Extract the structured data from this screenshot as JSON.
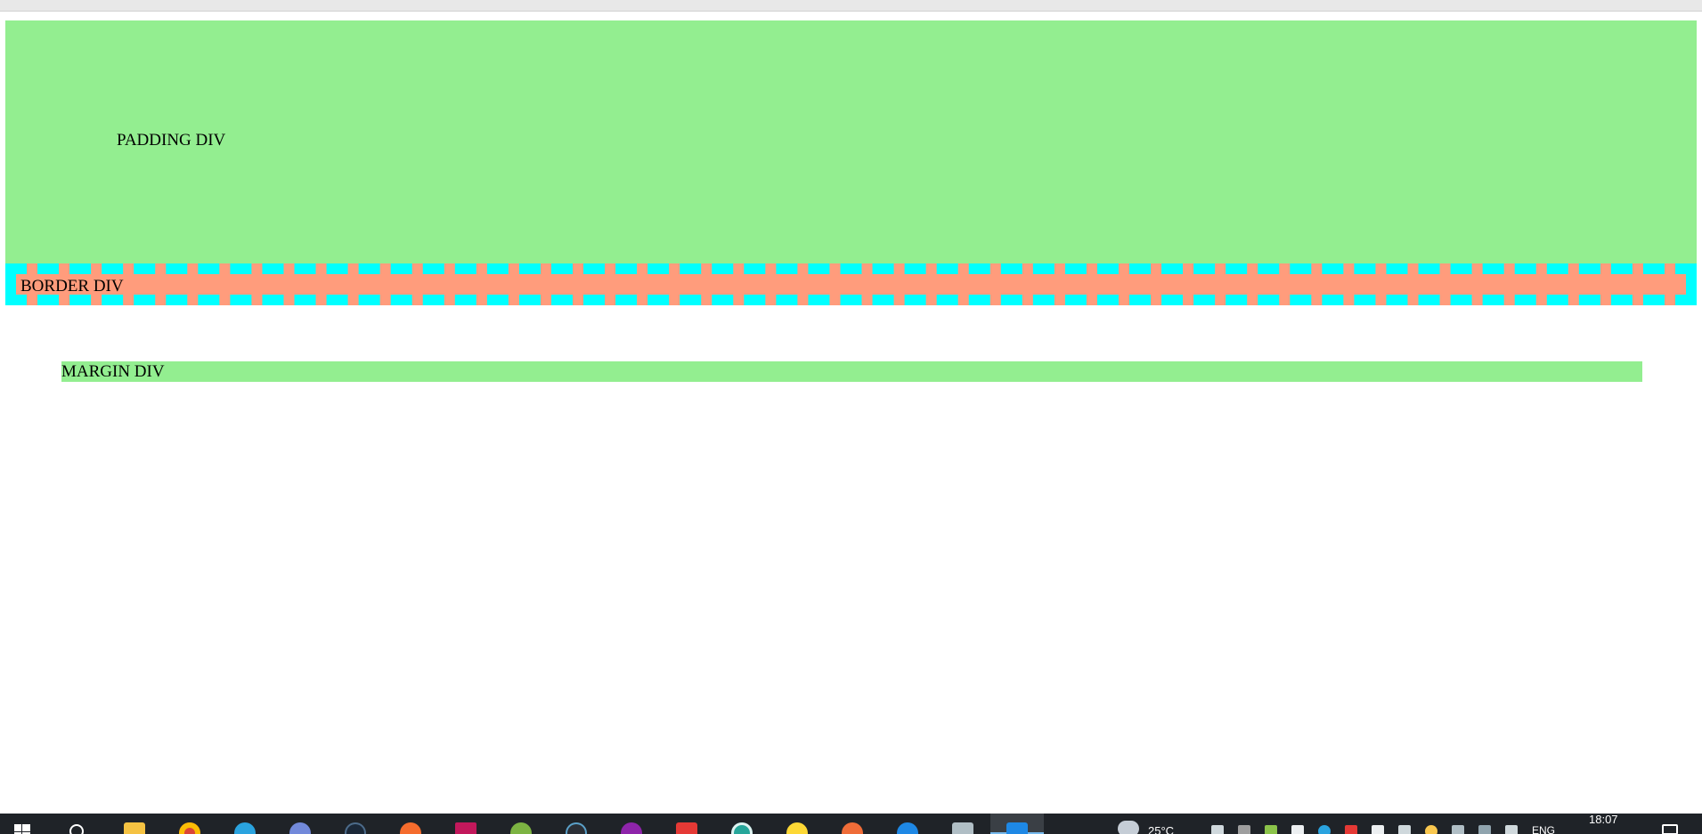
{
  "page": {
    "padding_div_label": "PADDING DIV",
    "border_div_label": "BORDER DIV",
    "margin_div_label": "MARGIN DIV"
  },
  "colors": {
    "light_green": "#93ee90",
    "salmon": "#ff9c7c",
    "aqua_border": "#00ffff"
  },
  "taskbar": {
    "apps": [
      {
        "name": "start-icon"
      },
      {
        "name": "search-icon"
      },
      {
        "name": "file-explorer-icon"
      },
      {
        "name": "chrome-icon"
      },
      {
        "name": "telegram-icon"
      },
      {
        "name": "discord-icon"
      },
      {
        "name": "steam-icon"
      },
      {
        "name": "origin-icon"
      },
      {
        "name": "intellij-icon"
      },
      {
        "name": "xampp-icon"
      },
      {
        "name": "epic-games-icon"
      },
      {
        "name": "podcast-icon"
      },
      {
        "name": "readly-icon"
      },
      {
        "name": "tor-icon"
      },
      {
        "name": "norton-icon"
      },
      {
        "name": "postman-icon"
      },
      {
        "name": "sqlmanager-icon"
      },
      {
        "name": "paint-icon"
      },
      {
        "name": "vscode-icon"
      }
    ],
    "weather_temp": "25°C",
    "language": "ENG",
    "time": "18:07"
  }
}
